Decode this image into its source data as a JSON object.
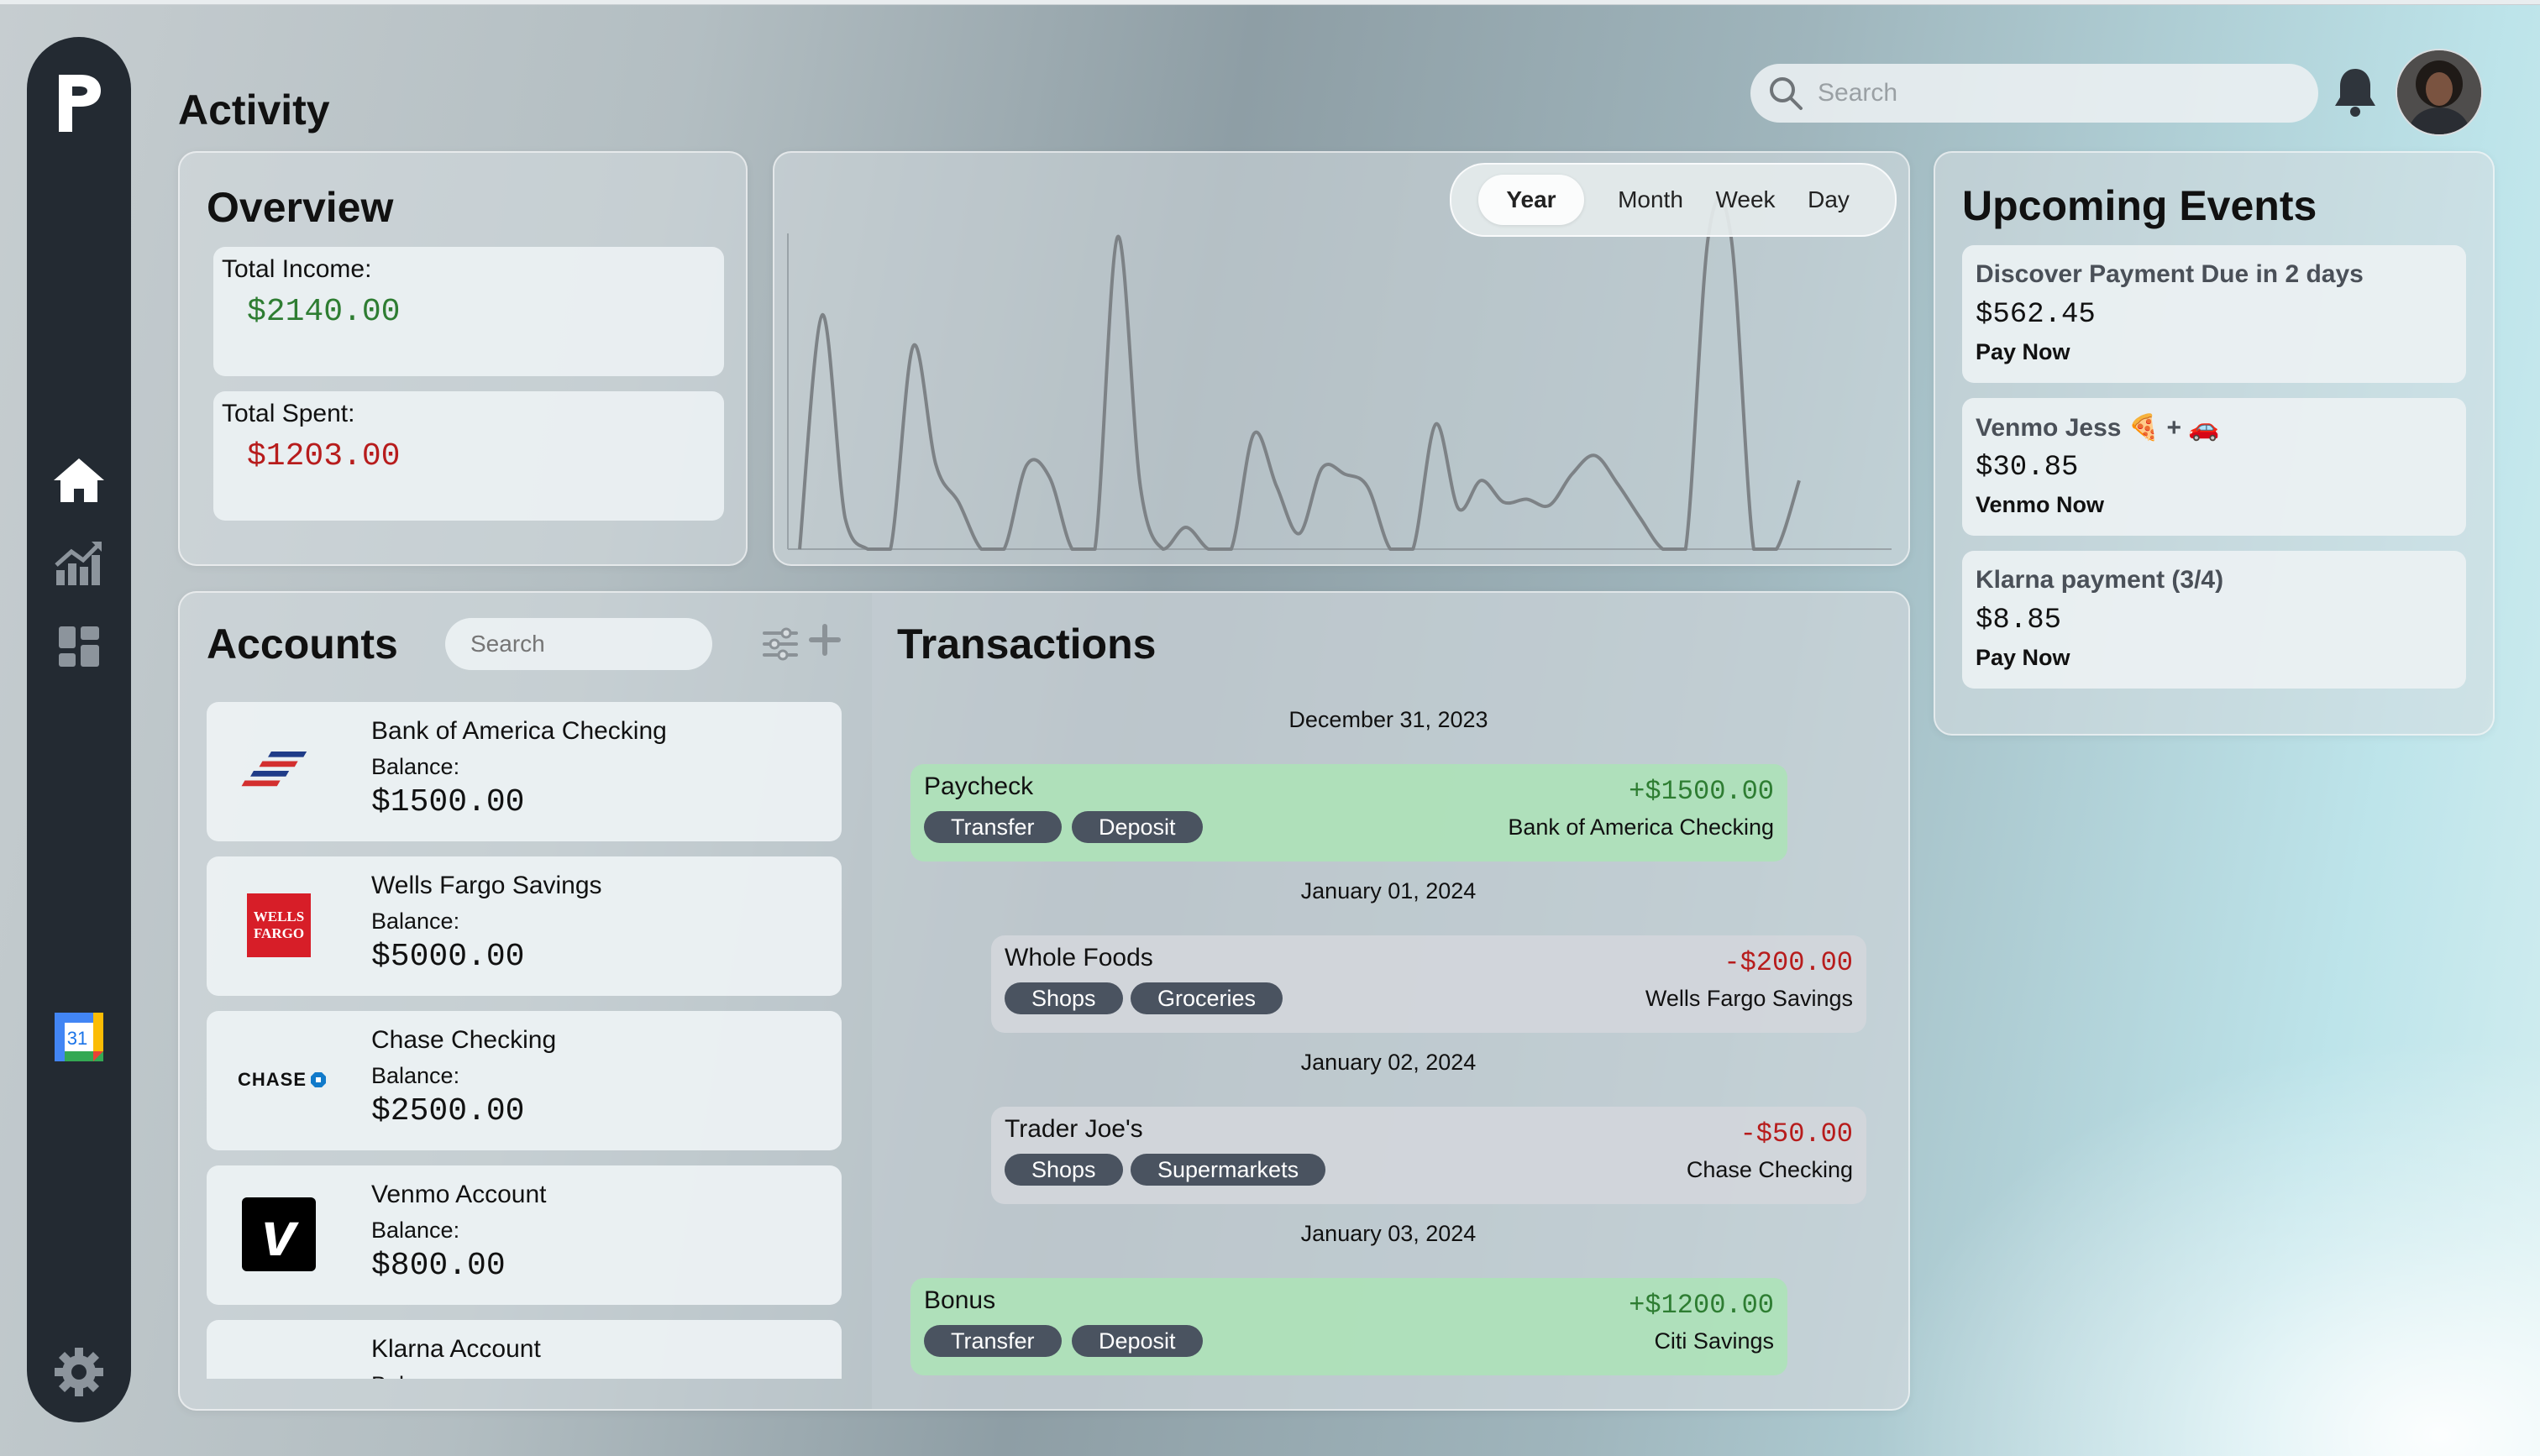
{
  "page": {
    "title": "Activity"
  },
  "search": {
    "placeholder": "Search"
  },
  "sidebar": {
    "logo": "P",
    "items": [
      {
        "icon": "home-icon"
      },
      {
        "icon": "chart-icon"
      },
      {
        "icon": "dashboard-icon"
      },
      {
        "icon": "calendar-icon",
        "label": "31"
      },
      {
        "icon": "gear-icon"
      }
    ]
  },
  "overview": {
    "title": "Overview",
    "income_label": "Total Income:",
    "income_value": "$2140.00",
    "spent_label": "Total Spent:",
    "spent_value": "$1203.00"
  },
  "period_tabs": {
    "items": [
      "Year",
      "Month",
      "Week",
      "Day"
    ],
    "active": "Year"
  },
  "accounts": {
    "title": "Accounts",
    "search_placeholder": "Search",
    "items": [
      {
        "name": "Bank of America Checking",
        "balance_label": "Balance:",
        "balance": "$1500.00",
        "logo": "bank-of-america-logo"
      },
      {
        "name": "Wells Fargo Savings",
        "balance_label": "Balance:",
        "balance": "$5000.00",
        "logo": "wells-fargo-logo",
        "logo_text_1": "WELLS",
        "logo_text_2": "FARGO"
      },
      {
        "name": "Chase Checking",
        "balance_label": "Balance:",
        "balance": "$2500.00",
        "logo": "chase-logo",
        "logo_text": "CHASE"
      },
      {
        "name": "Venmo Account",
        "balance_label": "Balance:",
        "balance": "$800.00",
        "logo": "venmo-logo",
        "logo_text": "v"
      },
      {
        "name": "Klarna Account",
        "balance_label": "Balance:",
        "balance": "",
        "logo": "klarna-logo"
      }
    ]
  },
  "transactions": {
    "title": "Transactions",
    "groups": [
      {
        "date": "December 31, 2023",
        "items": [
          {
            "name": "Paycheck",
            "amount": "+$1500.00",
            "account": "Bank of America Checking",
            "tags": [
              "Transfer",
              "Deposit"
            ],
            "kind": "in"
          }
        ]
      },
      {
        "date": "January 01, 2024",
        "items": [
          {
            "name": "Whole Foods",
            "amount": "-$200.00",
            "account": "Wells Fargo Savings",
            "tags": [
              "Shops",
              "Groceries"
            ],
            "kind": "out"
          }
        ]
      },
      {
        "date": "January 02, 2024",
        "items": [
          {
            "name": "Trader Joe's",
            "amount": "-$50.00",
            "account": "Chase Checking",
            "tags": [
              "Shops",
              "Supermarkets"
            ],
            "kind": "out"
          }
        ]
      },
      {
        "date": "January 03, 2024",
        "items": [
          {
            "name": "Bonus",
            "amount": "+$1200.00",
            "account": "Citi Savings",
            "tags": [
              "Transfer",
              "Deposit"
            ],
            "kind": "in"
          }
        ]
      }
    ]
  },
  "events": {
    "title": "Upcoming Events",
    "items": [
      {
        "title": "Discover Payment Due in 2 days",
        "amount": "$562.45",
        "action": "Pay Now"
      },
      {
        "title": "Venmo Jess 🍕 + 🚗",
        "amount": "$30.85",
        "action": "Venmo Now"
      },
      {
        "title": "Klarna payment (3/4)",
        "amount": "$8.85",
        "action": "Pay Now"
      }
    ]
  },
  "colors": {
    "income": "#2e7d32",
    "spent": "#b71c1c",
    "sidebar": "#232a32",
    "tag": "#4a5360"
  },
  "chart_data": {
    "type": "line",
    "title": "",
    "xlabel": "",
    "ylabel": "",
    "grid": false,
    "series": [
      {
        "values": [
          0,
          75,
          10,
          0,
          0,
          65,
          27,
          15,
          0,
          0,
          27,
          23,
          0,
          0,
          100,
          20,
          0,
          7,
          0,
          0,
          37,
          20,
          5,
          26,
          24,
          20,
          0,
          0,
          40,
          13,
          22,
          15,
          16,
          14,
          24,
          30,
          21,
          10,
          0,
          0,
          100,
          100,
          0,
          0,
          22
        ]
      }
    ]
  }
}
